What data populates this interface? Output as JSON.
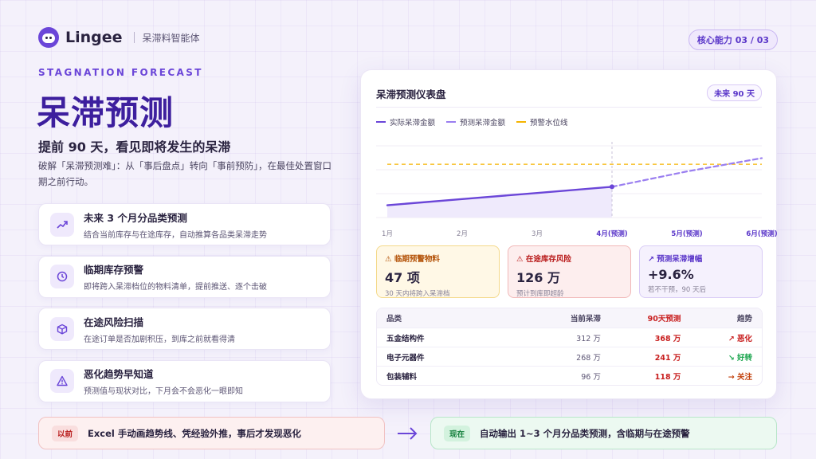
{
  "brand": {
    "name": "Lingee",
    "product": "呆滞料智能体"
  },
  "badge": {
    "label": "核心能力 03 / 03"
  },
  "hero": {
    "eyebrow": "STAGNATION FORECAST",
    "title": "呆滞预测",
    "subtitle": "提前 90 天，看见即将发生的呆滞",
    "description": "破解「呆滞预测难」：从「事后盘点」转向「事前预防」，在最佳处置窗口期之前行动。"
  },
  "features": [
    {
      "title": "未来 3 个月分品类预测",
      "desc": "结合当前库存与在途库存，自动推算各品类呆滞走势",
      "icon": "trend-up-icon"
    },
    {
      "title": "临期库存预警",
      "desc": "即将跨入呆滞档位的物料清单，提前推送、逐个击破",
      "icon": "clock-icon"
    },
    {
      "title": "在途风险扫描",
      "desc": "在途订单是否加剧积压，到库之前就看得清",
      "icon": "box-icon"
    },
    {
      "title": "恶化趋势早知道",
      "desc": "预测值与现状对比，下月会不会恶化一眼即知",
      "icon": "warning-icon"
    }
  ],
  "dashboard": {
    "title": "呆滞预测仪表盘",
    "range": "未来 90 天",
    "legend": {
      "actual": "实际呆滞金额",
      "forecast": "预测呆滞金额",
      "warning": "预警水位线"
    },
    "colors": {
      "actual": "#6b46d8",
      "forecast": "#9a7ef0",
      "warning": "#f5b400"
    },
    "stats": [
      {
        "label": "⚠ 临期预警物料",
        "value": "47 项",
        "note": "30 天内将跨入呆滞档"
      },
      {
        "label": "⚠ 在途库存风险",
        "value": "126 万",
        "note": "预计到库即超龄"
      },
      {
        "label": "↗ 预测呆滞增幅",
        "value": "+9.6%",
        "note": "若不干预，90 天后"
      }
    ],
    "table": {
      "headers": [
        "品类",
        "当前呆滞",
        "90天预测",
        "趋势"
      ],
      "rows": [
        {
          "name": "五金结构件",
          "current": "312 万",
          "forecast": "368 万",
          "trend": "↗ 恶化"
        },
        {
          "name": "电子元器件",
          "current": "268 万",
          "forecast": "241 万",
          "trend": "↘ 好转"
        },
        {
          "name": "包装辅料",
          "current": "96 万",
          "forecast": "118 万",
          "trend": "→ 关注"
        }
      ]
    }
  },
  "chart_data": {
    "type": "line",
    "categories": [
      "1月",
      "2月",
      "3月",
      "4月(预测)",
      "5月(预测)",
      "6月(预测)"
    ],
    "series": [
      {
        "name": "实际呆滞金额",
        "values": [
          12,
          18,
          24,
          30,
          null,
          null
        ]
      },
      {
        "name": "预测呆滞金额",
        "values": [
          null,
          null,
          null,
          30,
          45,
          58
        ]
      },
      {
        "name": "预警水位线",
        "values": [
          52,
          52,
          52,
          52,
          52,
          52
        ]
      }
    ],
    "grid": true,
    "legend": "top-left"
  },
  "comparison": {
    "before_tag": "以前",
    "before_text": "Excel 手动画趋势线、凭经验外推，事后才发现恶化",
    "after_tag": "现在",
    "after_text": "自动输出 1~3 个月分品类预测，含临期与在途预警"
  }
}
